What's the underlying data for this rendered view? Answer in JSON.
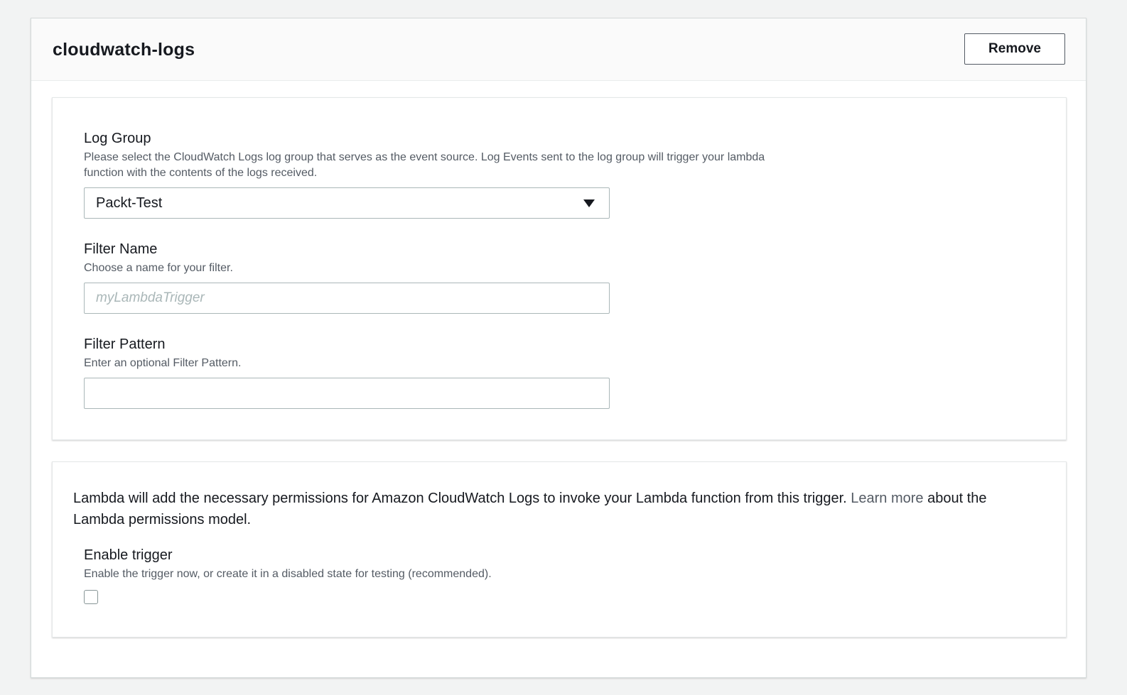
{
  "card": {
    "title": "cloudwatch-logs",
    "remove_label": "Remove"
  },
  "log_group": {
    "label": "Log Group",
    "description": "Please select the CloudWatch Logs log group that serves as the event source. Log Events sent to the log group will trigger your lambda function with the contents of the logs received.",
    "selected_value": "Packt-Test",
    "caret_icon": "triangle-down-icon"
  },
  "filter_name": {
    "label": "Filter Name",
    "description": "Choose a name for your filter.",
    "value": "",
    "placeholder": "myLambdaTrigger"
  },
  "filter_pattern": {
    "label": "Filter Pattern",
    "description": "Enter an optional Filter Pattern.",
    "value": "",
    "placeholder": ""
  },
  "permissions": {
    "text": "Lambda will add the necessary permissions for Amazon CloudWatch Logs to invoke your Lambda function from this trigger. ",
    "link_text": "Learn more",
    "link_suffix": " about the Lambda permissions model."
  },
  "enable_trigger": {
    "label": "Enable trigger",
    "description": "Enable the trigger now, or create it in a disabled state for testing (recommended).",
    "checked": false
  },
  "colors": {
    "page_background": "#f2f3f3",
    "text_primary": "#16191f",
    "text_secondary": "#545b64",
    "border": "#aab7b8"
  }
}
